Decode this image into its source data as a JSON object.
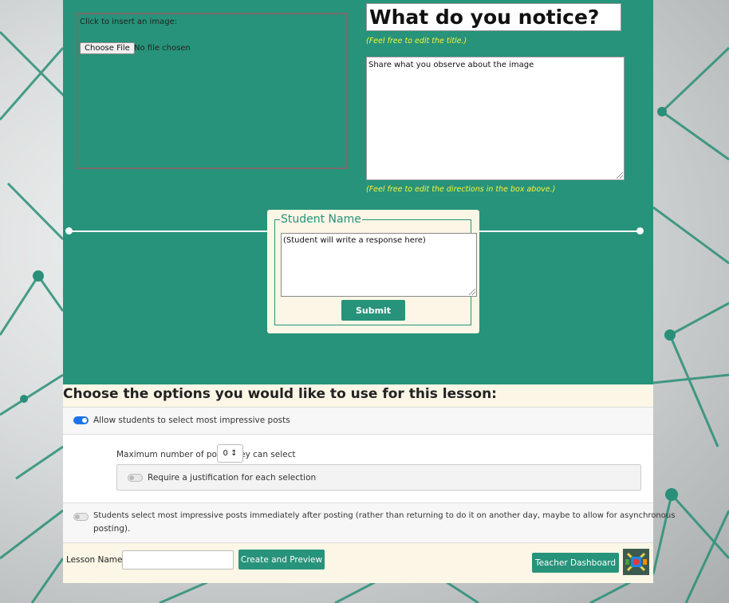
{
  "image_panel": {
    "hint": "Click to insert an image:",
    "choose_file_label": "Choose File",
    "file_status": "No file chosen"
  },
  "prompt": {
    "title": "What do you notice?",
    "title_note": "(Feel free to edit the title.)",
    "directions": "Share what you observe about the image",
    "directions_note": "(Feel free to edit the directions in the box above.)"
  },
  "student_card": {
    "legend": "Student Name",
    "response_placeholder": "(Student will write a response here)",
    "submit_label": "Submit"
  },
  "options": {
    "heading": "Choose the options you would like to use for this lesson:",
    "allow_select": {
      "label": "Allow students to select most impressive posts",
      "enabled": true
    },
    "max_posts": {
      "label": "Maximum number of posts they can select",
      "value": "0 ↕"
    },
    "justification": {
      "label": "Require a justification for each selection",
      "enabled": false
    },
    "immediate": {
      "label_line1": "Students select most impressive posts immediately after posting (rather than returning to do it on another day, maybe to allow for asynchronous",
      "label_line2": "posting).",
      "enabled": false
    }
  },
  "footer": {
    "lesson_name_label": "Lesson Name:",
    "lesson_name_value": "",
    "create_preview_label": "Create and Preview",
    "teacher_dashboard_label": "Teacher Dashboard"
  },
  "colors": {
    "primary_green": "#27937a",
    "cream": "#fbf6e6",
    "note_yellow": "#f5f542",
    "toggle_on": "#1a73e8"
  }
}
